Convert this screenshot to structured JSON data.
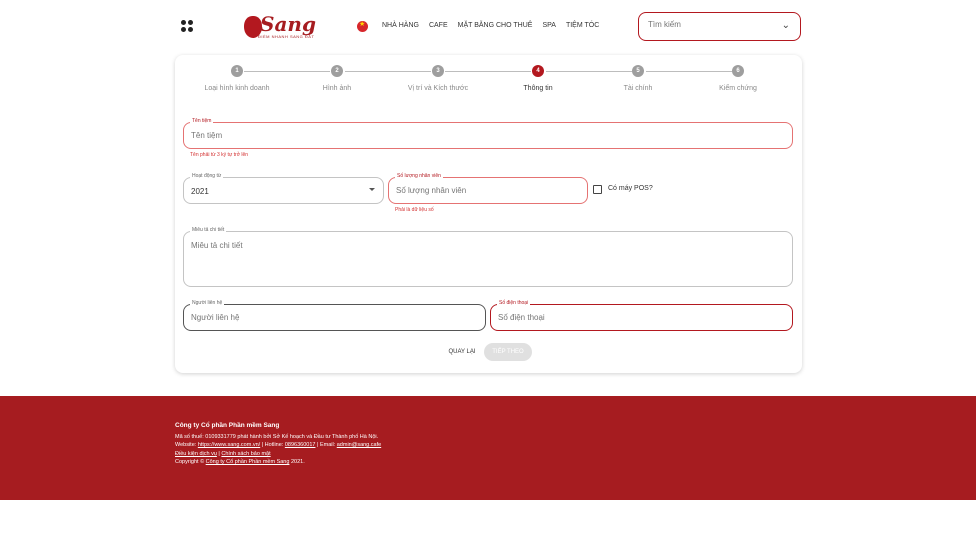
{
  "header": {
    "logo_text": "Sang",
    "logo_sub": "ĐIỂM NHANH SANG ĐẮT",
    "nav": [
      "NHÀ HÀNG",
      "CAFE",
      "MẶT BẰNG CHO THUÊ",
      "SPA",
      "TIỆM TÓC"
    ],
    "search_placeholder": "Tìm kiếm"
  },
  "steps": [
    {
      "num": "1",
      "label": "Loại hình kinh doanh",
      "active": false
    },
    {
      "num": "2",
      "label": "Hình ảnh",
      "active": false
    },
    {
      "num": "3",
      "label": "Vị trí và Kích thước",
      "active": false
    },
    {
      "num": "4",
      "label": "Thông tin",
      "active": true
    },
    {
      "num": "5",
      "label": "Tài chính",
      "active": false
    },
    {
      "num": "6",
      "label": "Kiểm chứng",
      "active": false
    }
  ],
  "form": {
    "shop_name": {
      "label": "Tên tiệm",
      "placeholder": "Tên tiệm",
      "error": "Tên phải từ 3 ký tự trở lên"
    },
    "active_since": {
      "label": "Hoạt động từ",
      "value": "2021"
    },
    "staff_count": {
      "label": "Số lượng nhân viên",
      "placeholder": "Số lượng nhân viên",
      "error": "Phải là dữ liệu số"
    },
    "pos": {
      "label": "Có máy POS?",
      "checked": false
    },
    "description": {
      "label": "Miêu tả chi tiết",
      "placeholder": "Miêu tả chi tiết"
    },
    "contact": {
      "label": "Người liên hệ",
      "placeholder": "Người liên hệ"
    },
    "phone": {
      "label": "Số điện thoại",
      "placeholder": "Số điện thoại"
    },
    "back_label": "QUAY LẠI",
    "next_label": "TIẾP THEO"
  },
  "footer": {
    "company": "Công ty Cổ phần Phần mềm Sang",
    "tax": "Mã số thuế: 0109331779 phát hành bởi Sở Kế hoạch và Đầu tư Thành phố Hà Nội.",
    "website_prefix": "Website: ",
    "website": "https://www.sang.com.vn/",
    "hotline_prefix": " | Hotline: ",
    "hotline": "0896360017",
    "email_prefix": " | Email: ",
    "email": "admin@sang.cafe",
    "terms": "Điều kiện dịch vụ",
    "sep": " | ",
    "privacy": "Chính sách bảo mật",
    "copyright_prefix": "Copyright © ",
    "copyright_company": "Công ty Cổ phần Phần mềm Sang",
    "copyright_year": " 2021."
  },
  "colors": {
    "brand": "#a61c20",
    "accent": "#b3181f"
  }
}
